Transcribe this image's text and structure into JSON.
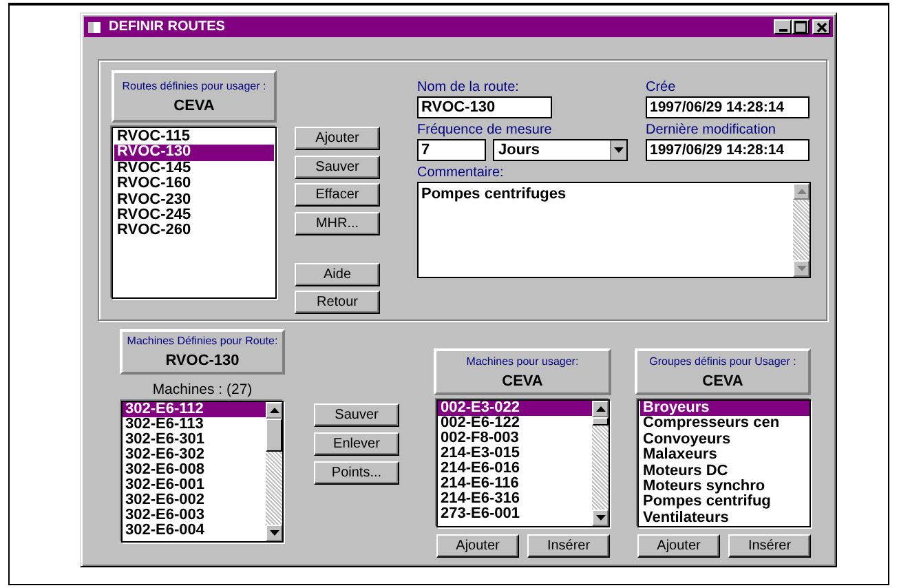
{
  "window": {
    "title": "DEFINIR ROUTES"
  },
  "routes": {
    "header": "Routes définies pour usager :",
    "user": "CEVA",
    "items": [
      {
        "label": "RVOC-115",
        "selected": false
      },
      {
        "label": "RVOC-130",
        "selected": true
      },
      {
        "label": "RVOC-145",
        "selected": false
      },
      {
        "label": "RVOC-160",
        "selected": false
      },
      {
        "label": "RVOC-230",
        "selected": false
      },
      {
        "label": "RVOC-245",
        "selected": false
      },
      {
        "label": "RVOC-260",
        "selected": false
      }
    ]
  },
  "route_actions": [
    "Ajouter",
    "Sauver",
    "Effacer",
    "MHR..."
  ],
  "route_nav": [
    "Aide",
    "Retour"
  ],
  "route_form": {
    "name_label": "Nom de la route:",
    "name": "RVOC-130",
    "created_label": "Crée",
    "created": "1997/06/29 14:28:14",
    "frequency_label": "Fréquence de mesure",
    "frequency_value": "7",
    "frequency_unit": "Jours",
    "modified_label": "Dernière modification",
    "modified": "1997/06/29 14:28:14",
    "comment_label": "Commentaire:",
    "comment": "Pompes centrifuges"
  },
  "route_machines": {
    "header": "Machines Définies pour Route:",
    "route": "RVOC-130",
    "count_label": "Machines : (27)",
    "items": [
      {
        "label": "302-E6-112",
        "selected": true
      },
      {
        "label": "302-E6-113",
        "selected": false
      },
      {
        "label": "302-E6-301",
        "selected": false
      },
      {
        "label": "302-E6-302",
        "selected": false
      },
      {
        "label": "302-E6-008",
        "selected": false
      },
      {
        "label": "302-E6-001",
        "selected": false
      },
      {
        "label": "302-E6-002",
        "selected": false
      },
      {
        "label": "302-E6-003",
        "selected": false
      },
      {
        "label": "302-E6-004",
        "selected": false
      }
    ]
  },
  "machine_buttons": [
    "Sauver",
    "Enlever",
    "Points..."
  ],
  "user_machines": {
    "header": "Machines pour usager:",
    "user": "CEVA",
    "items": [
      {
        "label": "002-E3-022",
        "selected": true
      },
      {
        "label": "002-E6-122",
        "selected": false
      },
      {
        "label": "002-F8-003",
        "selected": false
      },
      {
        "label": "214-E3-015",
        "selected": false
      },
      {
        "label": "214-E6-016",
        "selected": false
      },
      {
        "label": "214-E6-116",
        "selected": false
      },
      {
        "label": "214-E6-316",
        "selected": false
      },
      {
        "label": "273-E6-001",
        "selected": false
      }
    ],
    "buttons": [
      "Ajouter",
      "Insérer"
    ]
  },
  "user_groups": {
    "header": "Groupes définis pour Usager :",
    "user": "CEVA",
    "items": [
      {
        "label": "Broyeurs",
        "selected": true
      },
      {
        "label": "Compresseurs cen",
        "selected": false
      },
      {
        "label": "Convoyeurs",
        "selected": false
      },
      {
        "label": "Malaxeurs",
        "selected": false
      },
      {
        "label": "Moteurs DC",
        "selected": false
      },
      {
        "label": "Moteurs synchro",
        "selected": false
      },
      {
        "label": "Pompes centrifug",
        "selected": false
      },
      {
        "label": "Ventilateurs",
        "selected": false
      }
    ],
    "buttons": [
      "Ajouter",
      "Insérer"
    ]
  }
}
